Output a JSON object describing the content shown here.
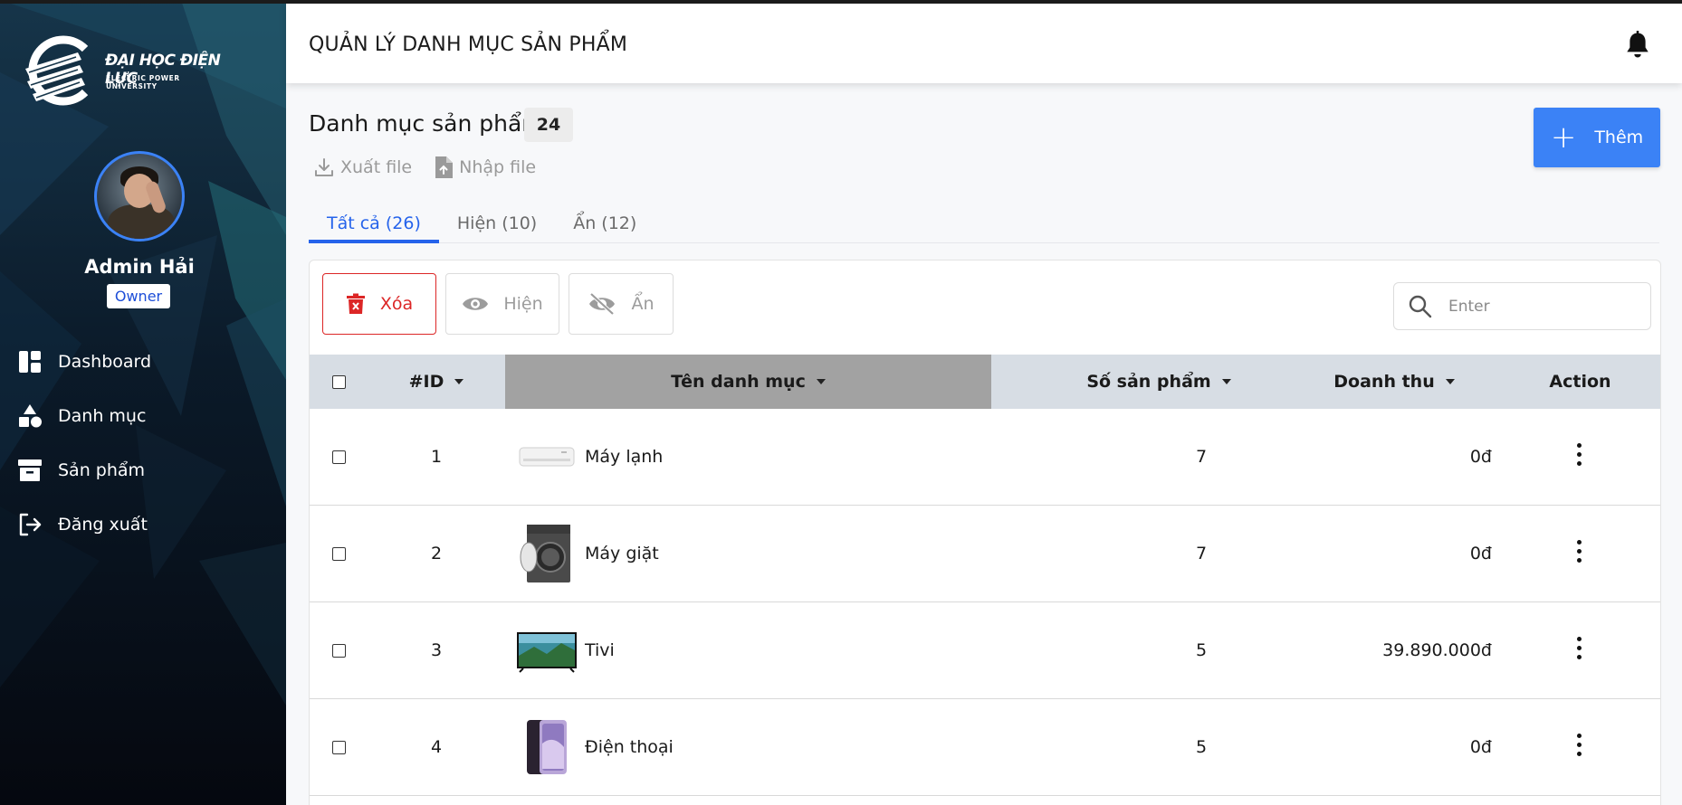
{
  "sidebar": {
    "logo_title": "ĐẠI HỌC ĐIỆN LỰC",
    "logo_subtitle": "ELECTRIC POWER UNIVERSITY",
    "user_name": "Admin Hải",
    "user_role": "Owner",
    "items": [
      {
        "label": "Dashboard",
        "icon": "dashboard-icon"
      },
      {
        "label": "Danh mục",
        "icon": "shapes-icon"
      },
      {
        "label": "Sản phẩm",
        "icon": "archive-box-icon"
      },
      {
        "label": "Đăng xuất",
        "icon": "logout-icon"
      }
    ]
  },
  "header": {
    "title": "QUẢN LÝ DANH MỤC SẢN PHẨM",
    "bell_icon": "bell-icon"
  },
  "main": {
    "section_title": "Danh mục sản phẩm",
    "count": "24",
    "export_label": "Xuất file",
    "import_label": "Nhập file",
    "add_label": "Thêm",
    "tabs": [
      {
        "label": "Tất cả (26)",
        "active": true
      },
      {
        "label": "Hiện (10)",
        "active": false
      },
      {
        "label": "Ẩn (12)",
        "active": false
      }
    ],
    "toolbar": {
      "delete_label": "Xóa",
      "show_label": "Hiện",
      "hide_label": "Ẩn"
    },
    "search": {
      "placeholder": "Enter",
      "value": ""
    }
  },
  "table": {
    "columns": [
      "#ID",
      "Tên danh mục",
      "Số sản phẩm",
      "Doanh thu",
      "Action"
    ],
    "rows": [
      {
        "id": "1",
        "name": "Máy lạnh",
        "products": "7",
        "revenue": "0đ",
        "thumb": "air-conditioner"
      },
      {
        "id": "2",
        "name": "Máy giặt",
        "products": "7",
        "revenue": "0đ",
        "thumb": "washing-machine"
      },
      {
        "id": "3",
        "name": "Tivi",
        "products": "5",
        "revenue": "39.890.000đ",
        "thumb": "television"
      },
      {
        "id": "4",
        "name": "Điện thoại",
        "products": "5",
        "revenue": "0đ",
        "thumb": "smartphone"
      }
    ]
  },
  "colors": {
    "primary": "#3b82f6",
    "danger": "#dc2626",
    "table_header": "#d7dde4",
    "sorted_column": "#a2a2a2"
  }
}
